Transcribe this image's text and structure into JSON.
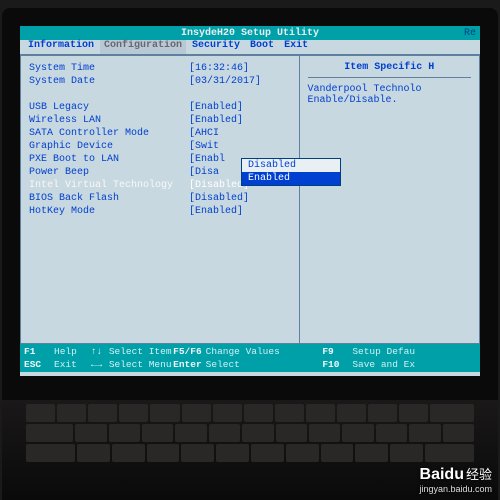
{
  "header": {
    "title": "InsydeH20 Setup Utility",
    "rev": "Re"
  },
  "menu": {
    "items": [
      "Information",
      "Configuration",
      "Security",
      "Boot",
      "Exit"
    ],
    "active": "Configuration"
  },
  "help_panel": {
    "title": "Item Specific H",
    "text1": "Vanderpool Technolo",
    "text2": "Enable/Disable."
  },
  "settings": [
    {
      "label": "System Time",
      "value": "[16:32:46]"
    },
    {
      "label": "System Date",
      "value": "[03/31/2017]"
    }
  ],
  "settings2": [
    {
      "label": "USB Legacy",
      "value": "[Enabled]"
    },
    {
      "label": "Wireless LAN",
      "value": "[Enabled]"
    },
    {
      "label": "SATA Controller Mode",
      "value": "[AHCI"
    },
    {
      "label": "Graphic Device",
      "value": "[Swit"
    },
    {
      "label": "PXE Boot to LAN",
      "value": "[Enabl"
    },
    {
      "label": "Power Beep",
      "value": "[Disa"
    },
    {
      "label": "Intel Virtual Technology",
      "value": "[Disabled]",
      "selected": true
    },
    {
      "label": "BIOS Back Flash",
      "value": "[Disabled]"
    },
    {
      "label": "HotKey Mode",
      "value": "[Enabled]"
    }
  ],
  "dropdown": {
    "options": [
      "Disabled",
      "Enabled"
    ],
    "selected": "Enabled"
  },
  "footer": {
    "f1": "F1",
    "f1t": "Help",
    "ud": "↑↓",
    "udt": "Select Item",
    "f56": "F5/F6",
    "f56t": "Change Values",
    "f9": "F9",
    "f9t": "Setup Defau",
    "esc": "ESC",
    "esct": "Exit",
    "lr": "←→",
    "lrt": "Select Menu",
    "ent": "Enter",
    "entt": "Select",
    "f10": "F10",
    "f10t": "Save and Ex"
  },
  "watermark": {
    "logo": "Baidu",
    "cn": "经验",
    "url": "jingyan.baidu.com"
  }
}
